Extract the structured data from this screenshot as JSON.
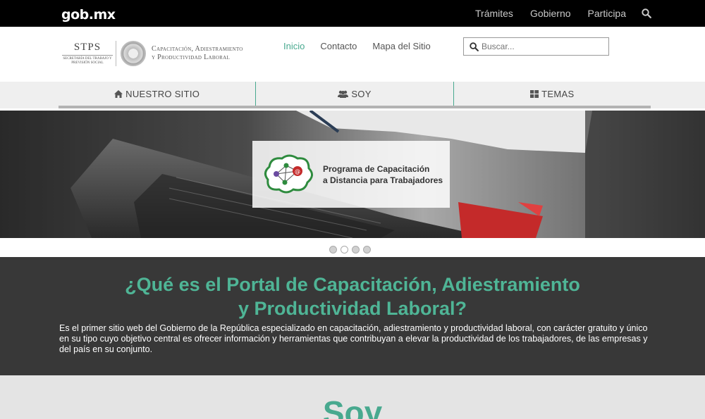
{
  "topbar": {
    "logo": "gob.mx",
    "nav": [
      "Trámites",
      "Gobierno",
      "Participa"
    ]
  },
  "header": {
    "stps_name": "STPS",
    "stps_sub": "SECRETARÍA DEL TRABAJO Y PREVISIÓN SOCIAL",
    "portal_name_1": "Capacitación, Adiestramiento",
    "portal_name_2": "y Productividad Laboral",
    "nav": {
      "inicio": "Inicio",
      "contacto": "Contacto",
      "mapa": "Mapa del Sitio"
    },
    "search_placeholder": "Buscar..."
  },
  "tabs": {
    "nuestro_sitio": "NUESTRO SITIO",
    "soy": "SOY",
    "temas": "TEMAS"
  },
  "banner": {
    "line1": "Programa de Capacitación",
    "line2": "a Distancia para Trabajadores",
    "active_slide": 2,
    "slides": 4
  },
  "about": {
    "title_line1": "¿Qué es el Portal de Capacitación, Adiestramiento",
    "title_line2": "y Productividad Laboral?",
    "text": "Es el primer sitio web del Gobierno de la República especializado en capacitación, adiestramiento y productividad laboral, con carácter gratuito y único en su tipo cuyo objetivo central es ofrecer información y herramientas que contribuyan a elevar la productividad de los trabajadores, de las empresas y del país en su conjunto."
  },
  "soy_section": {
    "title": "Soy"
  },
  "colors": {
    "accent": "#48a98f",
    "topbar": "#000000",
    "about_bg": "#383838"
  }
}
